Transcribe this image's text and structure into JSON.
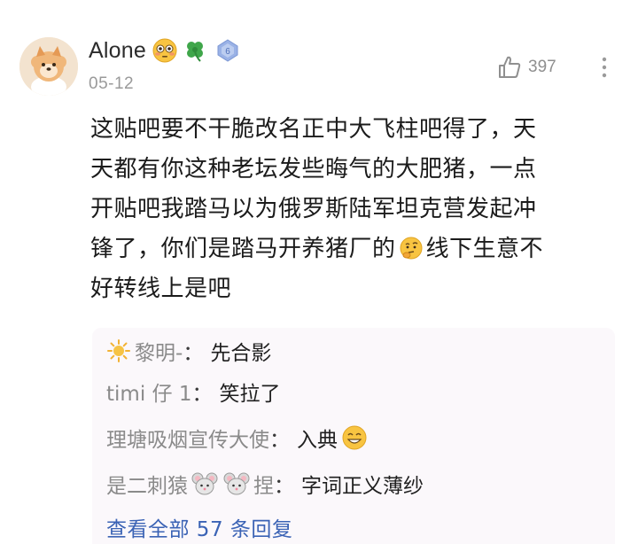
{
  "post": {
    "author": "Alone",
    "date": "05-12",
    "like_count": "397",
    "author_badges": [
      "flushed-face-emoji",
      "four-leaf-clover-emoji",
      "level-badge-icon"
    ],
    "level_badge_text": "6",
    "body_lines": [
      "这贴吧要不干脆改名正中大飞柱吧得了，天",
      "天都有你这种老坛发些晦气的大肥猪，一点",
      "开贴吧我踏马以为俄罗斯陆军坦克营发起冲",
      "锋了，你们是踏马开养猪厂的",
      "线下生意不",
      "好转线上是吧"
    ]
  },
  "replies": {
    "items": [
      {
        "name": "黎明-",
        "separator": "：",
        "text": "先合影"
      },
      {
        "name": "timi 仔 1",
        "separator": "：",
        "text": "笑拉了"
      },
      {
        "name": "理塘吸烟宣传大使",
        "separator": "：",
        "text": "入典"
      },
      {
        "name_prefix": "是二刺猿",
        "name_suffix": "捏",
        "separator": "：",
        "text": "字词正义薄纱"
      }
    ],
    "view_all": "查看全部 57 条回复"
  },
  "colors": {
    "username": "#2c2c2c",
    "muted": "#9a9a9a",
    "link": "#3b63b5",
    "reply_bg": "#fbf8fb"
  }
}
